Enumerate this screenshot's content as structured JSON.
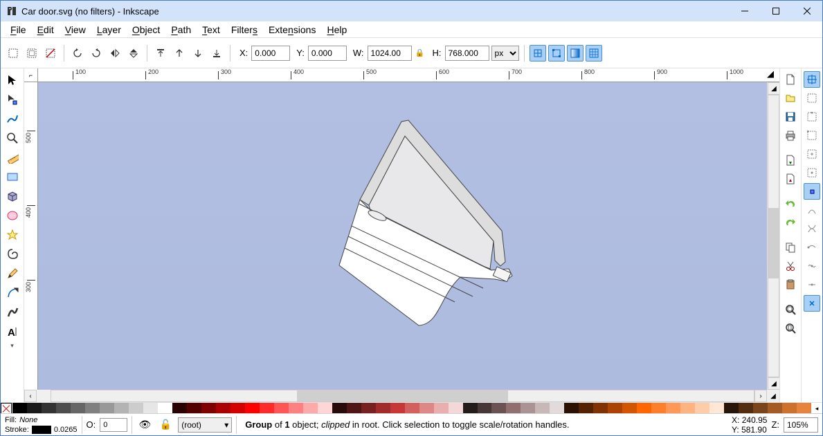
{
  "title": "Car door.svg (no filters) - Inkscape",
  "menu": [
    "File",
    "Edit",
    "View",
    "Layer",
    "Object",
    "Path",
    "Text",
    "Filters",
    "Extensions",
    "Help"
  ],
  "toolbar": {
    "x_label": "X:",
    "x": "0.000",
    "y_label": "Y:",
    "y": "0.000",
    "w_label": "W:",
    "w": "1024.00",
    "h_label": "H:",
    "h": "768.000",
    "units": "px"
  },
  "ruler_h": [
    100,
    200,
    300,
    400,
    500,
    600,
    700,
    800,
    900,
    1000
  ],
  "ruler_v": [
    500,
    400,
    300
  ],
  "status": {
    "fill_label": "Fill:",
    "fill_value": "None",
    "stroke_label": "Stroke:",
    "stroke_value": "0.0265",
    "o_label": "O:",
    "o_value": "0",
    "layer": "(root)",
    "msg_prefix": "Group",
    "msg_of": " of ",
    "msg_count": "1",
    "msg_obj": " object; ",
    "msg_clipped": "clipped",
    "msg_tail": " in root. Click selection to toggle scale/rotation handles.",
    "x_label": "X:",
    "x": "240.95",
    "y_label": "Y:",
    "y": "581.90",
    "z_label": "Z:",
    "zoom": "105%"
  },
  "swatches_gray": [
    "#000000",
    "#1a1a1a",
    "#333333",
    "#4d4d4d",
    "#666666",
    "#808080",
    "#999999",
    "#b3b3b3",
    "#cccccc",
    "#e6e6e6",
    "#ffffff"
  ],
  "swatches_colors": [
    "#2a0000",
    "#550000",
    "#800000",
    "#aa0000",
    "#d40000",
    "#ff0000",
    "#ff2a2a",
    "#ff5555",
    "#ff8080",
    "#ffaaaa",
    "#ffd5d5",
    "#280b0b",
    "#501616",
    "#782121",
    "#a02c2c",
    "#c83737",
    "#d35f5f",
    "#de8787",
    "#e9afaf",
    "#f4d7d7",
    "#241c1c",
    "#483737",
    "#6c5353",
    "#916f6f",
    "#ac9393",
    "#c8b7b7",
    "#e3dbdb",
    "#2b1100",
    "#552200",
    "#803300",
    "#aa4400",
    "#d45500",
    "#ff6600",
    "#ff7f2a",
    "#ff9955",
    "#ffb380",
    "#ffccaa",
    "#ffe6d5",
    "#291609",
    "#522d12",
    "#7b441b",
    "#a45b24",
    "#cd722d",
    "#e6843d"
  ],
  "swatches_tail": "◂"
}
